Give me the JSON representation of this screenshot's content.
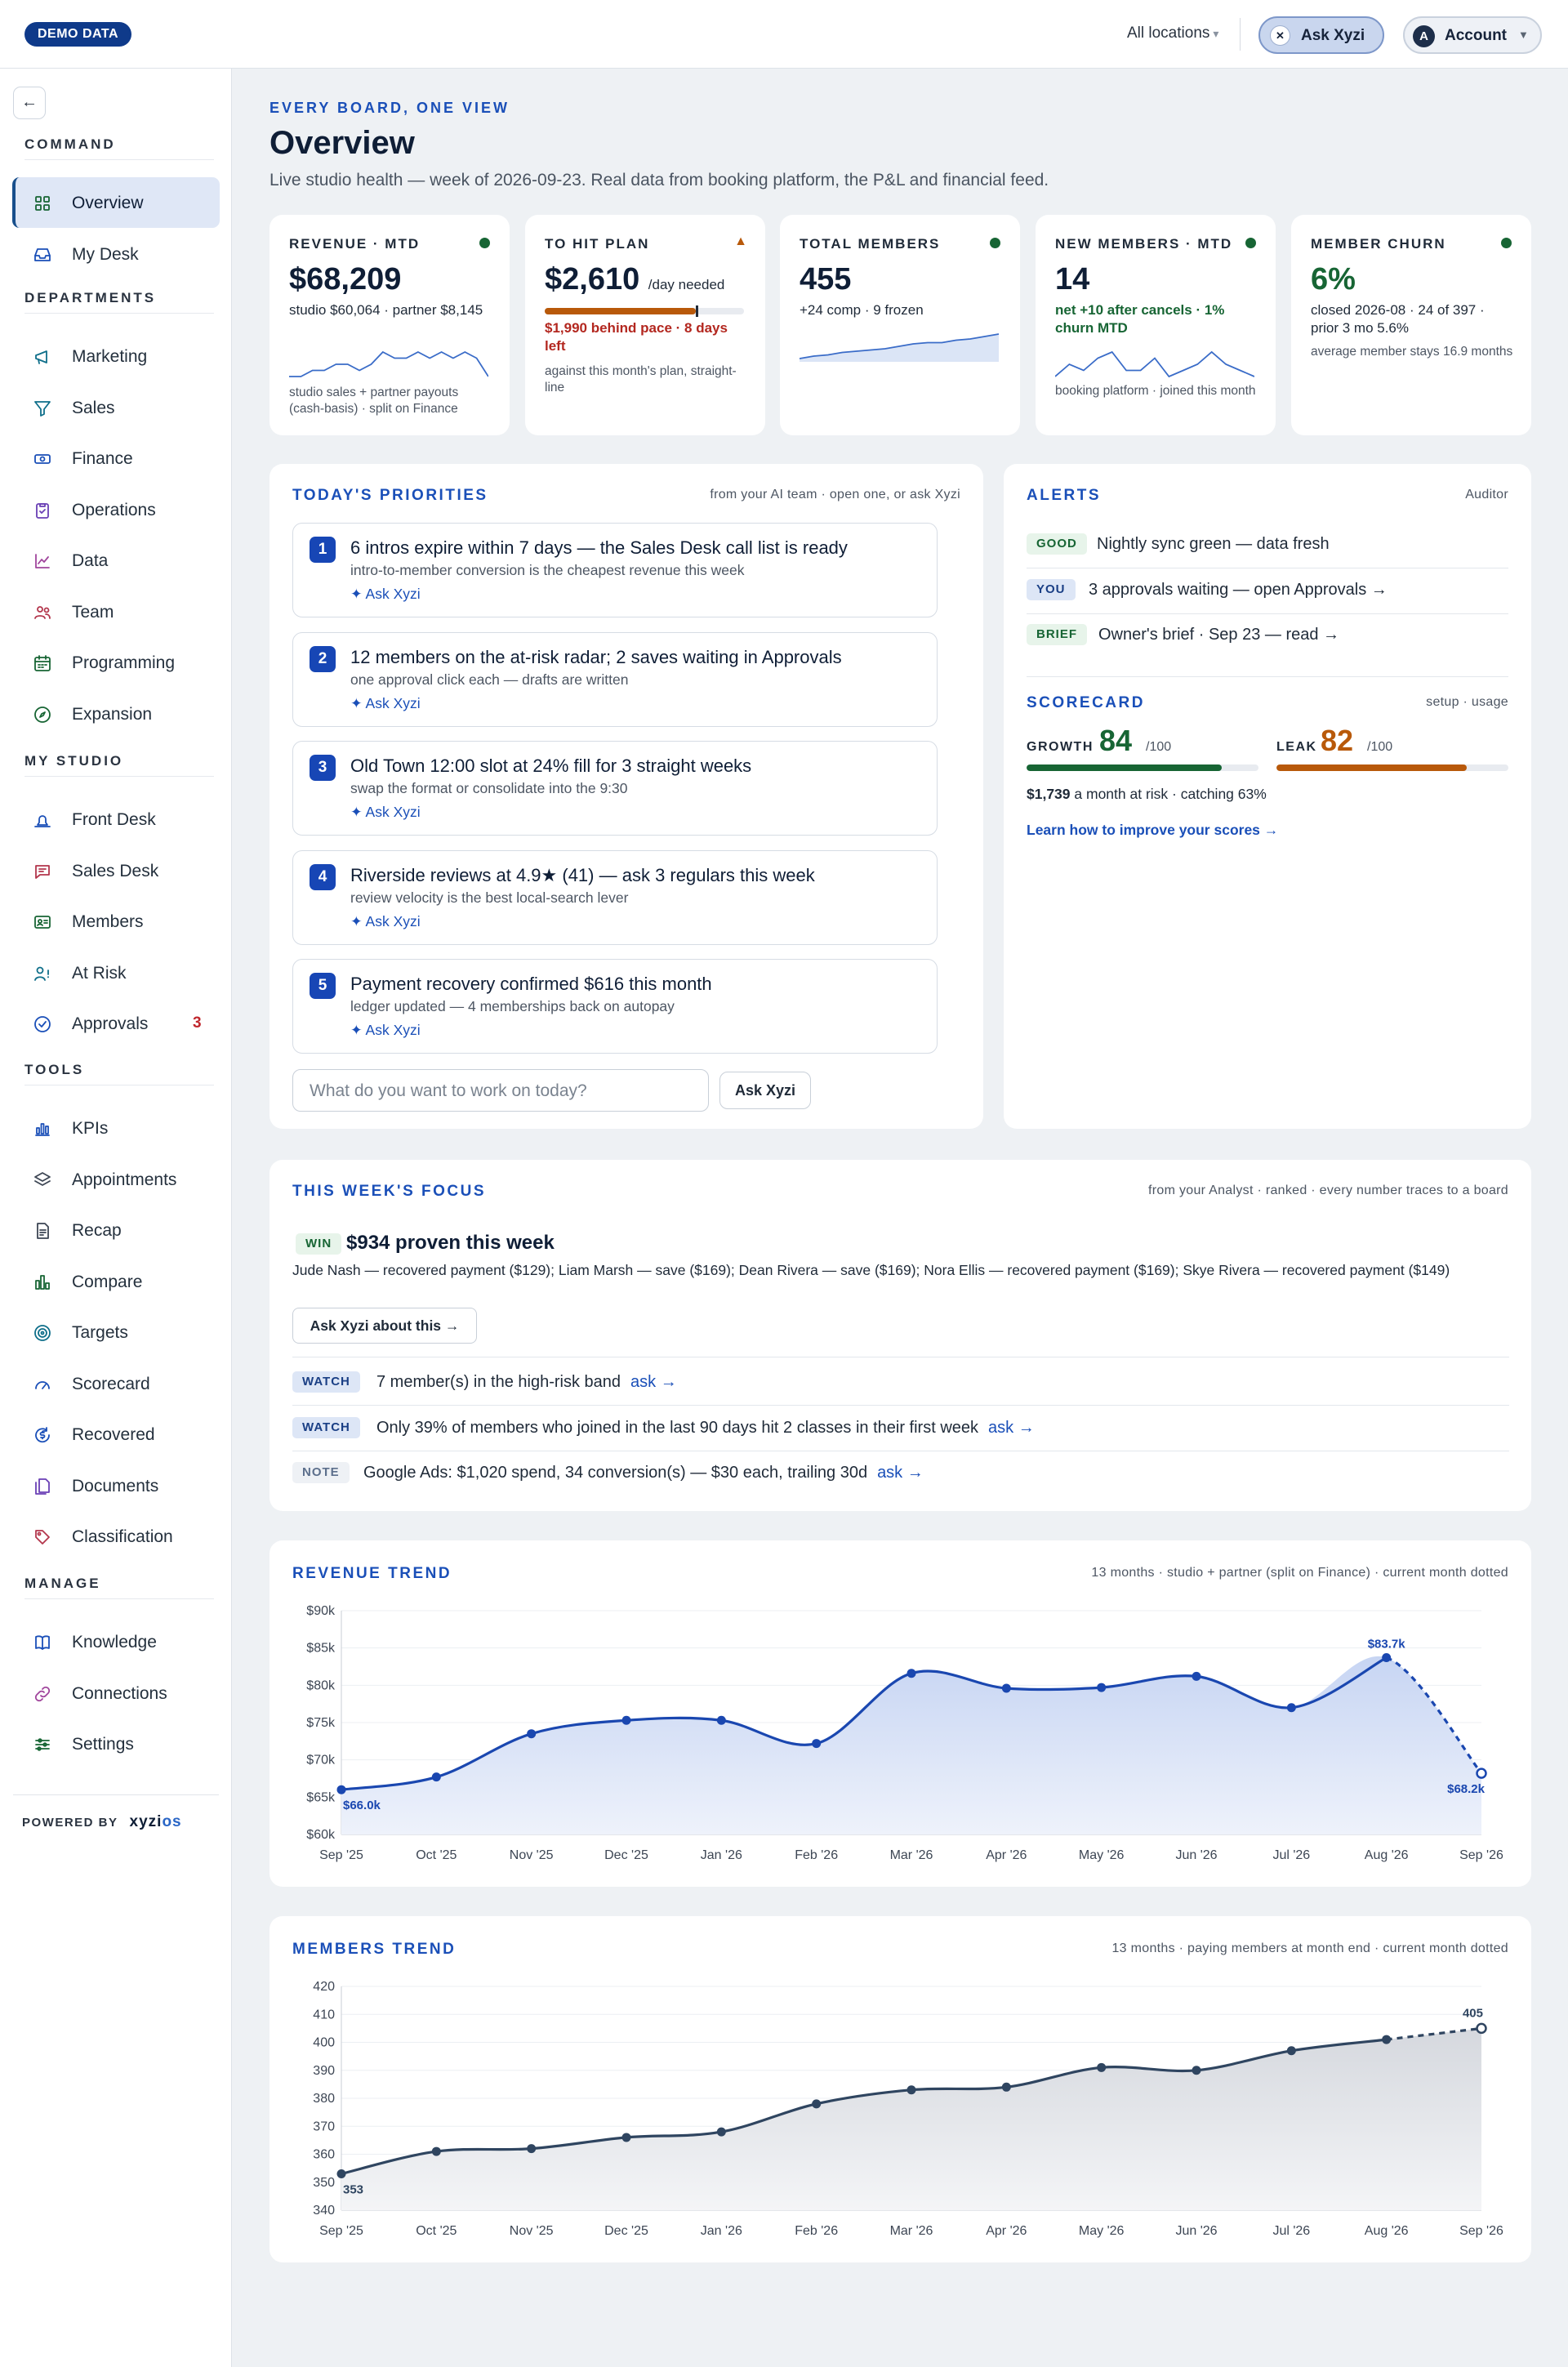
{
  "topbar": {
    "demo_badge": "DEMO DATA",
    "location": "All locations",
    "ask_label": "Ask Xyzi",
    "account_initial": "A",
    "account_label": "Account"
  },
  "sidebar": {
    "sections": [
      "COMMAND",
      "DEPARTMENTS",
      "MY STUDIO",
      "TOOLS",
      "MANAGE"
    ],
    "items": [
      {
        "label": "Overview",
        "icon": "grid-icon",
        "active": true
      },
      {
        "label": "My Desk",
        "icon": "inbox-icon"
      },
      {
        "label": "Marketing",
        "icon": "megaphone-icon"
      },
      {
        "label": "Sales",
        "icon": "funnel-icon"
      },
      {
        "label": "Finance",
        "icon": "banknote-icon"
      },
      {
        "label": "Operations",
        "icon": "clipboard-icon"
      },
      {
        "label": "Data",
        "icon": "line-chart-icon"
      },
      {
        "label": "Team",
        "icon": "users-icon"
      },
      {
        "label": "Programming",
        "icon": "calendar-icon"
      },
      {
        "label": "Expansion",
        "icon": "compass-icon"
      },
      {
        "label": "Front Desk",
        "icon": "bell-icon"
      },
      {
        "label": "Sales Desk",
        "icon": "chat-icon"
      },
      {
        "label": "Members",
        "icon": "id-card-icon"
      },
      {
        "label": "At Risk",
        "icon": "user-alert-icon"
      },
      {
        "label": "Approvals",
        "icon": "check-circle-icon",
        "count": "3"
      },
      {
        "label": "KPIs",
        "icon": "bar-chart-icon"
      },
      {
        "label": "Appointments",
        "icon": "layers-icon"
      },
      {
        "label": "Recap",
        "icon": "document-icon"
      },
      {
        "label": "Compare",
        "icon": "columns-icon"
      },
      {
        "label": "Targets",
        "icon": "target-icon"
      },
      {
        "label": "Scorecard",
        "icon": "gauge-icon"
      },
      {
        "label": "Recovered",
        "icon": "dollar-cycle-icon"
      },
      {
        "label": "Documents",
        "icon": "files-icon"
      },
      {
        "label": "Classification",
        "icon": "tag-icon"
      },
      {
        "label": "Knowledge",
        "icon": "book-icon"
      },
      {
        "label": "Connections",
        "icon": "link-icon"
      },
      {
        "label": "Settings",
        "icon": "sliders-icon"
      }
    ],
    "powered_by": "POWERED BY",
    "brand_a": "xyzi",
    "brand_b": "os"
  },
  "page": {
    "eyebrow": "EVERY BOARD, ONE VIEW",
    "title": "Overview",
    "subtitle": "Live studio health — week of 2026-09-23. Real data from booking platform, the P&L and financial feed."
  },
  "kpis": [
    {
      "label": "REVENUE · MTD",
      "value": "$68,209",
      "detail": "studio $60,064 · partner $8,145",
      "footer": "studio sales + partner payouts (cash-basis) · split on Finance",
      "status": "#176534",
      "spark": [
        3,
        3,
        4,
        4,
        5,
        5,
        4,
        5,
        7,
        6,
        6,
        7,
        6,
        7,
        6,
        7,
        6,
        3
      ]
    },
    {
      "label": "TO HIT PLAN",
      "value": "$2,610",
      "value_suffix": "/day needed",
      "detail": "$1,990 behind pace · 8 days left",
      "footer": "against this month's plan, straight-line",
      "progress": 0.76,
      "status": "#b8590a"
    },
    {
      "label": "TOTAL MEMBERS",
      "value": "455",
      "detail": "+24 comp · 9 frozen",
      "status": "#176534",
      "spark": [
        2,
        2.4,
        2.6,
        3,
        3.2,
        3.4,
        3.6,
        4,
        4.4,
        4.6,
        4.6,
        5,
        5.2,
        5.6,
        6
      ]
    },
    {
      "label": "NEW MEMBERS · MTD",
      "value": "14",
      "detail": "net +10 after cancels · 1% churn MTD",
      "footer": "booking platform · joined this month",
      "status": "#176534",
      "spark": [
        4,
        6,
        5,
        7,
        8,
        5,
        5,
        7,
        4,
        5,
        6,
        8,
        6,
        5,
        4
      ]
    },
    {
      "label": "MEMBER CHURN",
      "value": "6%",
      "detail": "closed 2026-08 · 24 of 397 · prior 3 mo 5.6%",
      "footer": "average member stays 16.9 months",
      "status": "#176534"
    }
  ],
  "priorities": {
    "title": "TODAY'S PRIORITIES",
    "aside": "from your AI team · open one, or ask Xyzi",
    "items": [
      {
        "n": "1",
        "title": "6 intros expire within 7 days — the Sales Desk call list is ready",
        "sub": "intro-to-member conversion is the cheapest revenue this week",
        "action": "✦ Ask Xyzi"
      },
      {
        "n": "2",
        "title": "12 members on the at-risk radar; 2 saves waiting in Approvals",
        "sub": "one approval click each — drafts are written",
        "action": "✦ Ask Xyzi"
      },
      {
        "n": "3",
        "title": "Old Town 12:00 slot at 24% fill for 3 straight weeks",
        "sub": "swap the format or consolidate into the 9:30",
        "action": "✦ Ask Xyzi"
      },
      {
        "n": "4",
        "title": "Riverside reviews at 4.9★ (41) — ask 3 regulars this week",
        "sub": "review velocity is the best local-search lever",
        "action": "✦ Ask Xyzi"
      },
      {
        "n": "5",
        "title": "Payment recovery confirmed $616 this month",
        "sub": "ledger updated — 4 memberships back on autopay",
        "action": "✦ Ask Xyzi"
      }
    ],
    "input_placeholder": "What do you want to work on today?",
    "input_button": "Ask Xyzi"
  },
  "alerts": {
    "title": "ALERTS",
    "aside": "Auditor",
    "items": [
      {
        "tag": "GOOD",
        "text": "Nightly sync green — data fresh"
      },
      {
        "tag": "YOU",
        "text": "3 approvals waiting — open Approvals →"
      },
      {
        "tag": "BRIEF",
        "text": "Owner's brief · Sep 23 — read →"
      }
    ]
  },
  "scorecard": {
    "title": "SCORECARD",
    "aside": "setup · usage",
    "growth_label": "GROWTH",
    "growth_value": "84",
    "growth_max": "/100",
    "growth_pct": 0.84,
    "growth_color": "#176534",
    "leak_label": "LEAK",
    "leak_value": "82",
    "leak_max": "/100",
    "leak_pct": 0.82,
    "leak_color": "#b8590a",
    "risk_value": "$1,739",
    "risk_text": "a month at risk · catching 63%",
    "link": "Learn how to improve your scores →"
  },
  "focus": {
    "title": "THIS WEEK'S FOCUS",
    "aside": "from your Analyst · ranked · every number traces to a board",
    "win_tag": "WIN",
    "win_title": "$934 proven this week",
    "win_detail": "Jude Nash — recovered payment ($129); Liam Marsh — save ($169); Dean Rivera — save ($169); Nora Ellis — recovered payment ($169); Skye Rivera — recovered payment ($149)",
    "win_button": "Ask Xyzi about this →",
    "rows": [
      {
        "tag": "WATCH",
        "text": "7 member(s) in the high-risk band",
        "action": "ask →"
      },
      {
        "tag": "WATCH",
        "text": "Only 39% of members who joined in the last 90 days hit 2 classes in their first week",
        "action": "ask →"
      },
      {
        "tag": "NOTE",
        "text": "Google Ads: $1,020 spend, 34 conversion(s) — $30 each, trailing 30d",
        "action": "ask →"
      }
    ]
  },
  "chart_data": [
    {
      "type": "area",
      "title": "REVENUE TREND",
      "subtitle": "13 months · studio + partner (split on Finance) · current month dotted",
      "categories": [
        "Sep '25",
        "Oct '25",
        "Nov '25",
        "Dec '25",
        "Jan '26",
        "Feb '26",
        "Mar '26",
        "Apr '26",
        "May '26",
        "Jun '26",
        "Jul '26",
        "Aug '26",
        "Sep '26"
      ],
      "values": [
        66.0,
        67.7,
        73.5,
        75.3,
        75.3,
        72.2,
        81.6,
        79.6,
        79.7,
        81.2,
        77.0,
        83.7,
        68.2
      ],
      "yticks": [
        "$60k",
        "$65k",
        "$70k",
        "$75k",
        "$80k",
        "$85k",
        "$90k"
      ],
      "ylim": [
        60,
        90
      ],
      "first_label": "$66.0k",
      "peak_label": "$83.7k",
      "last_label": "$68.2k",
      "color": "#1a47b0",
      "current_month_dotted": true
    },
    {
      "type": "area",
      "title": "MEMBERS TREND",
      "subtitle": "13 months · paying members at month end · current month dotted",
      "categories": [
        "Sep '25",
        "Oct '25",
        "Nov '25",
        "Dec '25",
        "Jan '26",
        "Feb '26",
        "Mar '26",
        "Apr '26",
        "May '26",
        "Jun '26",
        "Jul '26",
        "Aug '26",
        "Sep '26"
      ],
      "values": [
        353,
        361,
        362,
        366,
        368,
        378,
        383,
        384,
        391,
        390,
        397,
        401,
        405
      ],
      "yticks": [
        "340",
        "350",
        "360",
        "370",
        "380",
        "390",
        "400",
        "410",
        "420"
      ],
      "ylim": [
        340,
        420
      ],
      "first_label": "353",
      "last_label": "405",
      "color": "#2f4560",
      "current_month_dotted": true
    }
  ]
}
